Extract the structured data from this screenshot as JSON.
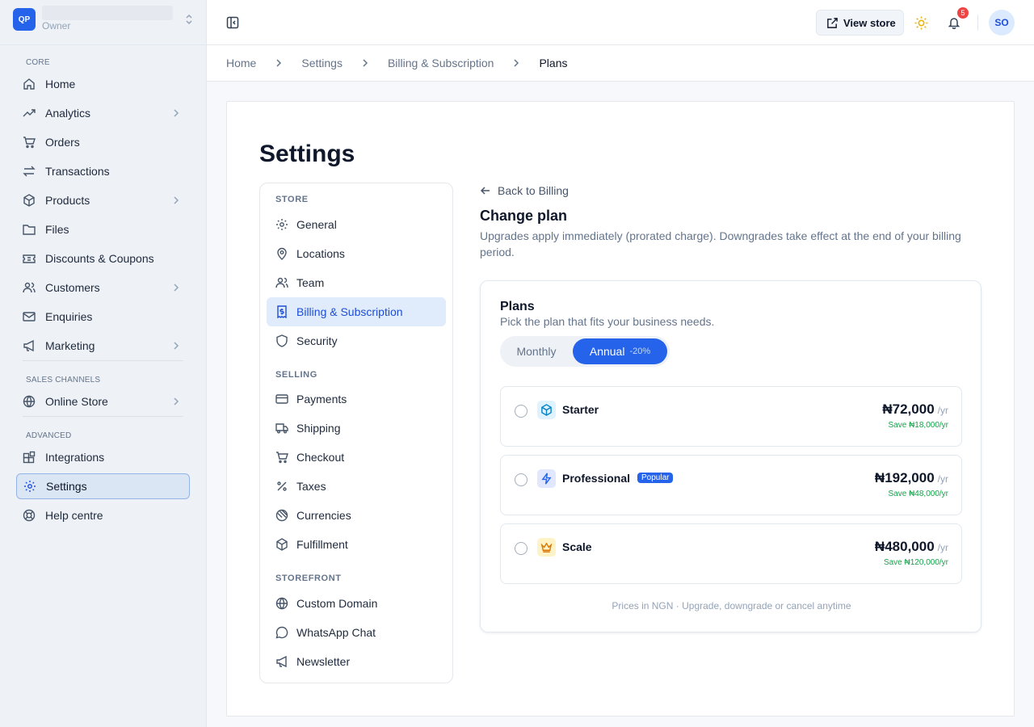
{
  "workspace": {
    "logo": "QP",
    "role": "Owner"
  },
  "sidebar": {
    "group_core": "CORE",
    "group_sales": "SALES CHANNELS",
    "group_advanced": "ADVANCED",
    "items": [
      {
        "label": "Home",
        "icon": "home-icon"
      },
      {
        "label": "Analytics",
        "icon": "trend-icon"
      },
      {
        "label": "Orders",
        "icon": "cart-icon"
      },
      {
        "label": "Transactions",
        "icon": "arrows-icon"
      },
      {
        "label": "Products",
        "icon": "box-icon"
      },
      {
        "label": "Files",
        "icon": "folder-icon"
      },
      {
        "label": "Discounts & Coupons",
        "icon": "ticket-icon"
      },
      {
        "label": "Customers",
        "icon": "users-icon"
      },
      {
        "label": "Enquiries",
        "icon": "mail-icon"
      },
      {
        "label": "Marketing",
        "icon": "megaphone-icon"
      },
      {
        "label": "Online Store",
        "icon": "globe-icon"
      },
      {
        "label": "Integrations",
        "icon": "blocks-icon"
      },
      {
        "label": "Settings",
        "icon": "gear-icon"
      },
      {
        "label": "Help centre",
        "icon": "lifebuoy-icon"
      }
    ]
  },
  "topbar": {
    "view_store": "View store",
    "notifications": "5",
    "avatar": "SO"
  },
  "breadcrumb": [
    "Home",
    "Settings",
    "Billing & Subscription",
    "Plans"
  ],
  "page": {
    "title": "Settings"
  },
  "settings_nav": {
    "store_label": "STORE",
    "selling_label": "SELLING",
    "storefront_label": "STOREFRONT",
    "items": [
      "General",
      "Locations",
      "Team",
      "Billing & Subscription",
      "Security",
      "Payments",
      "Shipping",
      "Checkout",
      "Taxes",
      "Currencies",
      "Fulfillment",
      "Custom Domain",
      "WhatsApp Chat",
      "Newsletter"
    ]
  },
  "change_plan": {
    "back": "Back to Billing",
    "title": "Change plan",
    "description": "Upgrades apply immediately (prorated charge). Downgrades take effect at the end of your billing period."
  },
  "plans": {
    "title": "Plans",
    "subtitle": "Pick the plan that fits your business needs.",
    "toggle_monthly": "Monthly",
    "toggle_annual": "Annual",
    "toggle_discount": "-20%",
    "popular_badge": "Popular",
    "period": "/yr",
    "list": [
      {
        "name": "Starter",
        "price": "₦72,000",
        "save": "Save ₦18,000/yr",
        "icon": "cube-icon"
      },
      {
        "name": "Professional",
        "price": "₦192,000",
        "save": "Save ₦48,000/yr",
        "icon": "bolt-icon"
      },
      {
        "name": "Scale",
        "price": "₦480,000",
        "save": "Save ₦120,000/yr",
        "icon": "crown-icon"
      }
    ],
    "footer": "Prices in NGN · Upgrade, downgrade or cancel anytime"
  },
  "colors": {
    "accent": "#2563eb",
    "save": "#16a34a",
    "badge": "#ef4444"
  }
}
